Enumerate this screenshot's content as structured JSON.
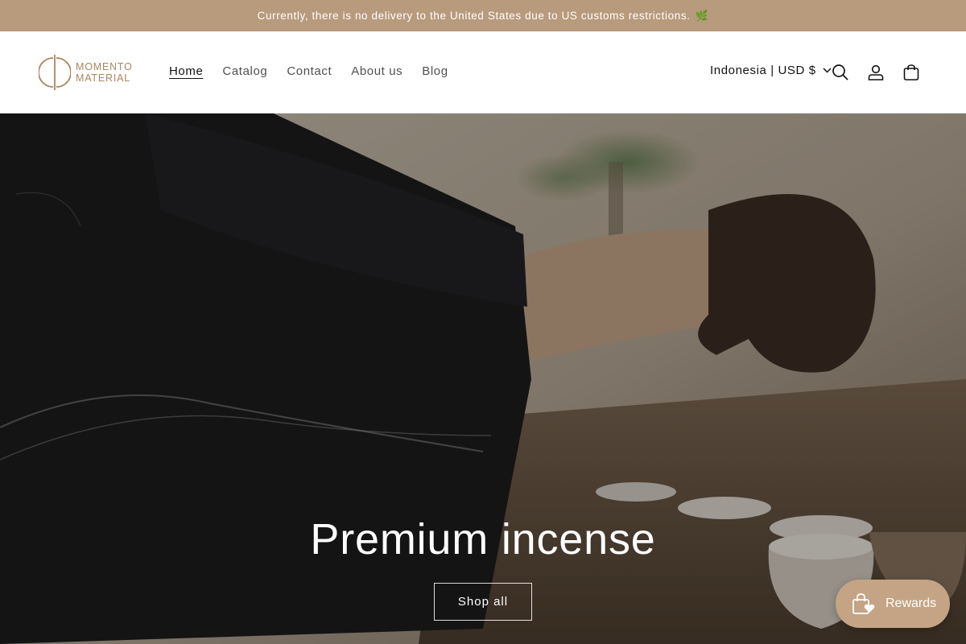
{
  "announcement": {
    "text": "Currently, there is no delivery to the United States due to US customs restrictions.",
    "emoji": "🌿"
  },
  "header": {
    "logo": {
      "line1": "MOMENTO",
      "line2": "MATERIAL",
      "icon": "momento-logo-icon"
    },
    "nav": [
      {
        "label": "Home",
        "active": true
      },
      {
        "label": "Catalog"
      },
      {
        "label": "Contact"
      },
      {
        "label": "About us"
      },
      {
        "label": "Blog"
      }
    ],
    "locale": "Indonesia | USD $",
    "icons": [
      "search-icon",
      "account-icon",
      "cart-icon"
    ]
  },
  "hero": {
    "title": "Premium incense",
    "button_label": "Shop all"
  },
  "rewards": {
    "label": "Rewards",
    "icon": "gift-bag-heart-icon"
  },
  "colors": {
    "announcement_bg": "#b89a7d",
    "logo": "#a7865f",
    "rewards_bg": "#c4a484"
  }
}
